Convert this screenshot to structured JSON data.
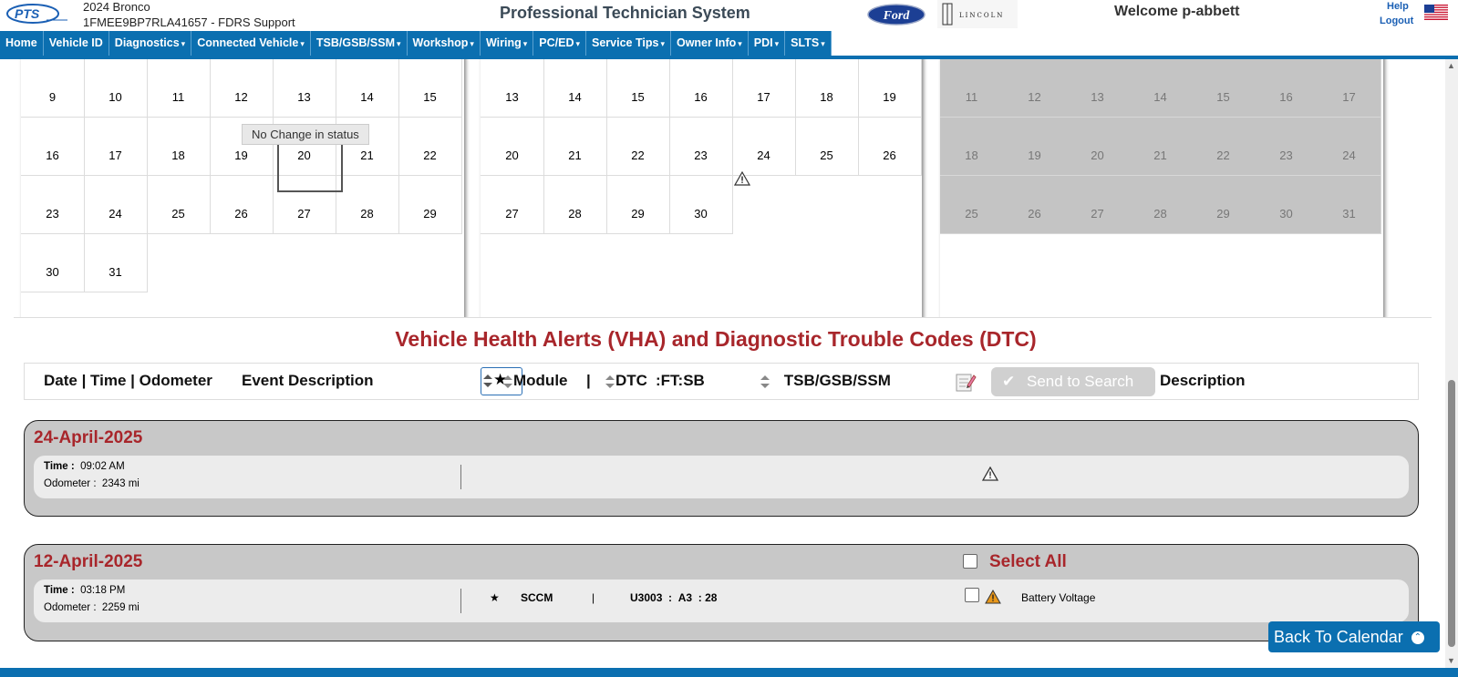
{
  "header": {
    "vehicle_name": "2024 Bronco",
    "vehicle_vin": "1FMEE9BP7RLA41657 - FDRS Support",
    "app_title": "Professional Technician System",
    "ford_logo_text": "Ford",
    "lincoln_logo_text": "LINCOLN",
    "welcome": "Welcome p-abbett",
    "help": "Help",
    "logout": "Logout"
  },
  "nav": {
    "items": [
      {
        "label": "Home",
        "dropdown": false
      },
      {
        "label": "Vehicle ID",
        "dropdown": false
      },
      {
        "label": "Diagnostics",
        "dropdown": true
      },
      {
        "label": "Connected Vehicle",
        "dropdown": true
      },
      {
        "label": "TSB/GSB/SSM",
        "dropdown": true
      },
      {
        "label": "Workshop",
        "dropdown": true
      },
      {
        "label": "Wiring",
        "dropdown": true
      },
      {
        "label": "PC/ED",
        "dropdown": true
      },
      {
        "label": "Service Tips",
        "dropdown": true
      },
      {
        "label": "Owner Info",
        "dropdown": true
      },
      {
        "label": "PDI",
        "dropdown": true
      },
      {
        "label": "SLTS",
        "dropdown": true
      }
    ]
  },
  "calendars": [
    {
      "rows": [
        [
          "",
          "",
          "",
          "",
          "",
          "",
          ""
        ],
        [
          "9",
          "10",
          "11",
          "12",
          "13",
          "14",
          "15"
        ],
        [
          "16",
          "17",
          "18",
          "19",
          "20",
          "21",
          "22"
        ],
        [
          "23",
          "24",
          "25",
          "26",
          "27",
          "28",
          "29"
        ],
        [
          "30",
          "31",
          "",
          "",
          "",
          "",
          ""
        ]
      ]
    },
    {
      "rows": [
        [
          "",
          "",
          "",
          "",
          "",
          "",
          ""
        ],
        [
          "13",
          "14",
          "15",
          "16",
          "17",
          "18",
          "19"
        ],
        [
          "20",
          "21",
          "22",
          "23",
          "24",
          "25",
          "26"
        ],
        [
          "27",
          "28",
          "29",
          "30",
          "",
          "",
          ""
        ],
        [
          "",
          "",
          "",
          "",
          "",
          "",
          ""
        ]
      ]
    },
    {
      "rows": [
        [
          "",
          "",
          "",
          "",
          "",
          "",
          ""
        ],
        [
          "11",
          "12",
          "13",
          "14",
          "15",
          "16",
          "17"
        ],
        [
          "18",
          "19",
          "20",
          "21",
          "22",
          "23",
          "24"
        ],
        [
          "25",
          "26",
          "27",
          "28",
          "29",
          "30",
          "31"
        ]
      ]
    }
  ],
  "tooltip": "No Change in status",
  "vha": {
    "title": "Vehicle Health Alerts (VHA) and Diagnostic Trouble Codes (DTC)",
    "col_date": "Date | Time | Odometer",
    "col_event": "Event Description",
    "col_module": "Module",
    "col_sep": "|",
    "col_dtc": "DTC",
    "col_ftsb": ":FT:SB",
    "col_tsb": "TSB/GSB/SSM",
    "send_to_search": "Send to Search",
    "col_description": "Description",
    "time_label": "Time :",
    "odometer_label": "Odometer :",
    "select_all": "Select All",
    "groups": [
      {
        "date": "24-April-2025",
        "time": "09:02 AM",
        "odometer": "2343 mi"
      },
      {
        "date": "12-April-2025",
        "time": "03:18 PM",
        "odometer": "2259 mi",
        "module": "SCCM",
        "dtc": "U3003",
        "ft": "A3",
        "sb": "28",
        "description": "Battery Voltage"
      }
    ]
  },
  "back_to_calendar": "Back To Calendar",
  "colors": {
    "brand_blue": "#0b6fb0",
    "title_red": "#a8262b",
    "warning_orange": "#e8971a"
  }
}
